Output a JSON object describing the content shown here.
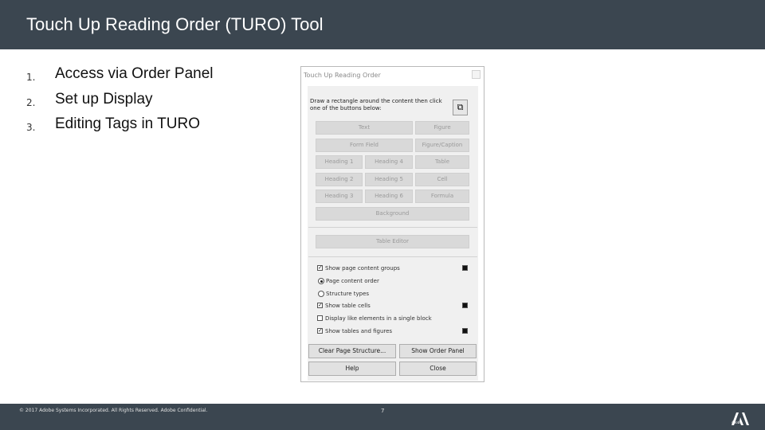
{
  "slide": {
    "title": "Touch Up Reading Order (TURO) Tool"
  },
  "list": [
    {
      "num": "1.",
      "text": "Access via Order Panel"
    },
    {
      "num": "2.",
      "text": "Set up Display"
    },
    {
      "num": "3.",
      "text": "Editing Tags in TURO"
    }
  ],
  "dialog": {
    "title": "Touch Up Reading Order",
    "instruction": "Draw a rectangle around the content then click one of the buttons below:",
    "tag_buttons": {
      "text": "Text",
      "figure": "Figure",
      "form_field": "Form Field",
      "figure_caption": "Figure/Caption",
      "heading1": "Heading 1",
      "heading4": "Heading 4",
      "table": "Table",
      "heading2": "Heading 2",
      "heading5": "Heading 5",
      "cell": "Cell",
      "heading3": "Heading 3",
      "heading6": "Heading 6",
      "formula": "Formula",
      "background": "Background"
    },
    "table_editor": "Table Editor",
    "options": {
      "show_groups": "Show page content groups",
      "page_content_order": "Page content order",
      "structure_types": "Structure types",
      "show_table_cells": "Show table cells",
      "display_like": "Display like elements in a single block",
      "show_tables_figures": "Show tables and figures"
    },
    "checks": {
      "show_groups": true,
      "show_table_cells": true,
      "display_like": false,
      "show_tables_figures": true
    },
    "selected_radio": "page_content_order",
    "bottom_buttons": {
      "clear": "Clear Page Structure...",
      "show_order": "Show Order Panel",
      "help": "Help",
      "close": "Close"
    }
  },
  "footer": {
    "copyright": "© 2017 Adobe Systems Incorporated. All Rights Reserved. Adobe Confidential.",
    "page": "7",
    "logo_text": "Adobe"
  },
  "colors": {
    "bar": "#3b4650",
    "dialog_bg": "#f0f0f0",
    "disabled_button": "#d9d9d9",
    "brand": "#ffffff"
  },
  "icons": {
    "pick": "picker-icon",
    "logo": "adobe-logo"
  }
}
